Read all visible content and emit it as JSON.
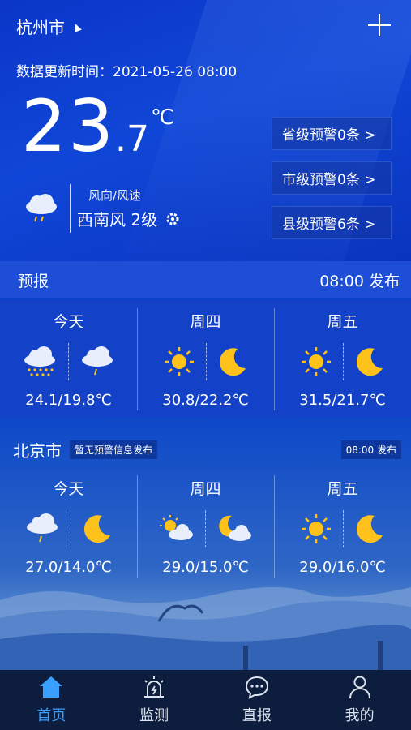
{
  "header": {
    "city": "杭州市",
    "updated": "数据更新时间：2021-05-26 08:00"
  },
  "current": {
    "temp_int": "23",
    "temp_dec": ".7",
    "unit": "℃",
    "wind_label": "风向/风速",
    "wind_value": "西南风 2级"
  },
  "alerts": [
    "省级预警0条 >",
    "市级预警0条 >",
    "县级预警6条 >"
  ],
  "forecast": {
    "title": "预报",
    "published": "08:00 发布",
    "days": [
      {
        "name": "今天",
        "range": "24.1/19.8℃",
        "icon_day": "heavy-rain-icon",
        "icon_night": "light-rain-icon"
      },
      {
        "name": "周四",
        "range": "30.8/22.2℃",
        "icon_day": "sun-icon",
        "icon_night": "moon-icon"
      },
      {
        "name": "周五",
        "range": "31.5/21.7℃",
        "icon_day": "sun-icon",
        "icon_night": "moon-icon"
      }
    ]
  },
  "beijing": {
    "city": "北京市",
    "notice": "暂无预警信息发布",
    "published": "08:00 发布",
    "days": [
      {
        "name": "今天",
        "range": "27.0/14.0℃",
        "icon_day": "light-rain-icon",
        "icon_night": "moon-icon"
      },
      {
        "name": "周四",
        "range": "29.0/15.0℃",
        "icon_day": "sun-cloud-icon",
        "icon_night": "moon-cloud-icon"
      },
      {
        "name": "周五",
        "range": "29.0/16.0℃",
        "icon_day": "sun-icon",
        "icon_night": "moon-icon"
      }
    ]
  },
  "nav": [
    {
      "label": "首页",
      "icon": "home-icon",
      "active": true
    },
    {
      "label": "监测",
      "icon": "alarm-icon"
    },
    {
      "label": "直报",
      "icon": "chat-icon"
    },
    {
      "label": "我的",
      "icon": "user-icon"
    }
  ],
  "colors": {
    "active_tab": "#3aa0ff",
    "nav_bg": "#0d1d3d",
    "sun": "#ffc21a",
    "moon": "#ffc21a"
  }
}
